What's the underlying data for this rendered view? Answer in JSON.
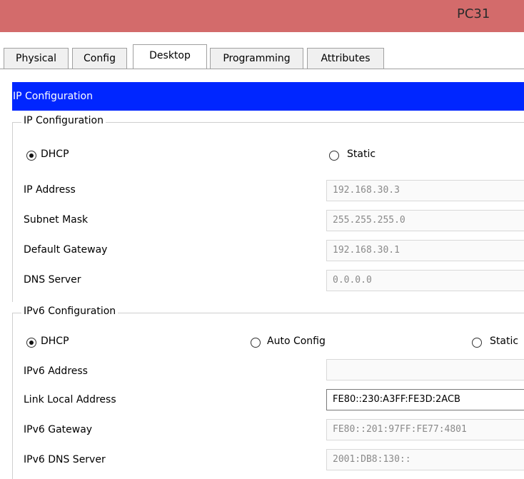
{
  "window": {
    "title": "PC31"
  },
  "tabs": [
    {
      "label": "Physical"
    },
    {
      "label": "Config"
    },
    {
      "label": "Desktop"
    },
    {
      "label": "Programming"
    },
    {
      "label": "Attributes"
    }
  ],
  "active_tab": "Desktop",
  "header": {
    "title": "IP Configuration"
  },
  "ipv4": {
    "section_title": "IP Configuration",
    "mode_options": [
      {
        "label": "DHCP",
        "selected": true
      },
      {
        "label": "Static",
        "selected": false
      }
    ],
    "fields": [
      {
        "label": "IP Address",
        "value": "192.168.30.3"
      },
      {
        "label": "Subnet Mask",
        "value": "255.255.255.0"
      },
      {
        "label": "Default Gateway",
        "value": "192.168.30.1"
      },
      {
        "label": "DNS Server",
        "value": "0.0.0.0"
      }
    ]
  },
  "ipv6": {
    "section_title": "IPv6 Configuration",
    "mode_options": [
      {
        "label": "DHCP",
        "selected": true
      },
      {
        "label": "Auto Config",
        "selected": false
      },
      {
        "label": "Static",
        "selected": false
      }
    ],
    "fields": [
      {
        "label": "IPv6 Address",
        "value": ""
      },
      {
        "label": "Link Local Address",
        "value": "FE80::230:A3FF:FE3D:2ACB"
      },
      {
        "label": "IPv6 Gateway",
        "value": "FE80::201:97FF:FE77:4801"
      },
      {
        "label": "IPv6 DNS Server",
        "value": "2001:DB8:130::"
      }
    ]
  },
  "colors": {
    "title_bar": "#d36b6b",
    "header_bar": "#0026ff",
    "header_text": "#ffffff"
  }
}
